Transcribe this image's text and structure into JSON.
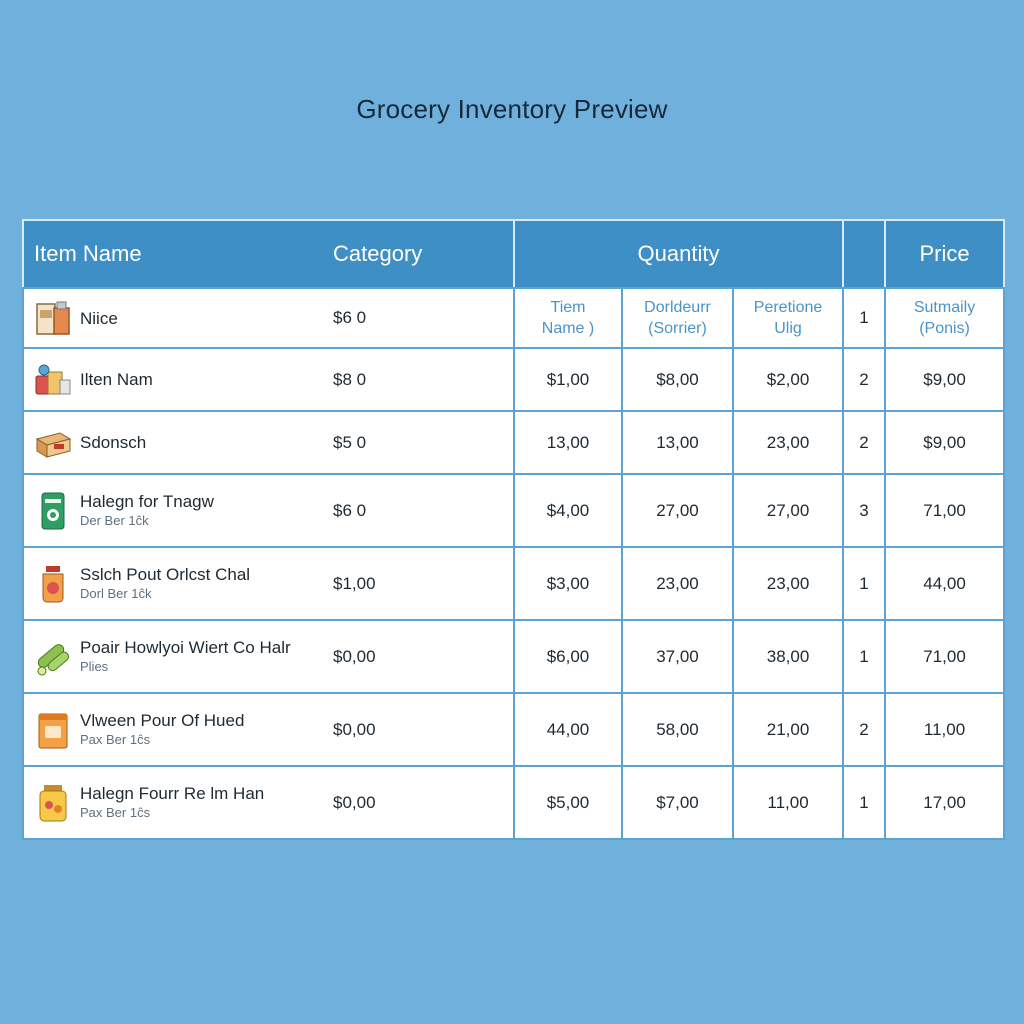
{
  "title": "Grocery Inventory Preview",
  "columns": {
    "item_name": "Item Name",
    "category": "Category",
    "quantity": "Quantity",
    "price": "Price"
  },
  "sub_headers": {
    "col1": "Tiem\nName )",
    "col2": "Dorldeurr\n(Sorrier)",
    "col3": "Peretione\nUlig",
    "col5": "Sutmaily\n(Ponis)"
  },
  "rows": [
    {
      "icon": "boxed-goods-icon",
      "name": "Niice",
      "sub": "",
      "category": "$6 0",
      "q1": "",
      "q2": "",
      "q3": "",
      "q4": "1",
      "price": ""
    },
    {
      "icon": "canned-goods-icon",
      "name": "Ilten Nam",
      "sub": "",
      "category": "$8 0",
      "q1": "$1,00",
      "q2": "$8,00",
      "q3": "$2,00",
      "q4": "2",
      "price": "$9,00"
    },
    {
      "icon": "cardboard-box-icon",
      "name": "Sdonsch",
      "sub": "",
      "category": "$5 0",
      "q1": "13,00",
      "q2": "13,00",
      "q3": "23,00",
      "q4": "2",
      "price": "$9,00"
    },
    {
      "icon": "green-bag-icon",
      "name": "Halegn for Tnagw",
      "sub": "Der Ber 1ĉk",
      "category": "$6 0",
      "q1": "$4,00",
      "q2": "27,00",
      "q3": "27,00",
      "q4": "3",
      "price": "71,00"
    },
    {
      "icon": "sauce-jar-icon",
      "name": "Sslch Pout Orlcst Chal",
      "sub": "Dorl Ber 1ĉk",
      "category": "$1,00",
      "q1": "$3,00",
      "q2": "23,00",
      "q3": "23,00",
      "q4": "1",
      "price": "44,00"
    },
    {
      "icon": "cucumber-icon",
      "name": "Poair Howlyoi Wiert Co Halr",
      "sub": "Plies",
      "category": "$0,00",
      "q1": "$6,00",
      "q2": "37,00",
      "q3": "38,00",
      "q4": "1",
      "price": "71,00"
    },
    {
      "icon": "orange-package-icon",
      "name": "Vlween Pour Of Hued",
      "sub": "Pax Ber 1ĉs",
      "category": "$0,00",
      "q1": "44,00",
      "q2": "58,00",
      "q3": "21,00",
      "q4": "2",
      "price": "11,00"
    },
    {
      "icon": "honey-jar-icon",
      "name": "Halegn Fourr Re lm Han",
      "sub": "Pax Ber 1ĉs",
      "category": "$0,00",
      "q1": "$5,00",
      "q2": "$7,00",
      "q3": "11,00",
      "q4": "1",
      "price": "17,00"
    }
  ],
  "colors": {
    "background": "#6fb1dc",
    "header": "#3f8fc7",
    "grid": "#5aa3d3",
    "subheader_text": "#4a94c9"
  }
}
